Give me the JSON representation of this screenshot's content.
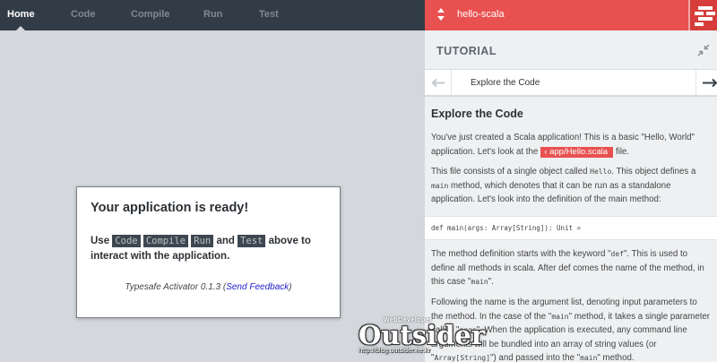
{
  "nav": {
    "tabs": [
      {
        "label": "Home",
        "active": true
      },
      {
        "label": "Code",
        "active": false
      },
      {
        "label": "Compile",
        "active": false
      },
      {
        "label": "Run",
        "active": false
      },
      {
        "label": "Test",
        "active": false
      }
    ]
  },
  "project": {
    "name": "hello-scala",
    "icons": [
      "project-switch-arrows-icon",
      "typesafe-logo-icon"
    ]
  },
  "main": {
    "card": {
      "title": "Your application is ready!",
      "line1_prefix": "Use",
      "chips": [
        "Code",
        "Compile",
        "Run",
        "Test"
      ],
      "line1_and": "and",
      "line1_suffix": "above to",
      "line2": "interact with the application.",
      "activator_text": "Typesafe Activator 0.1.3 (",
      "feedback_link": "Send Feedback",
      "activator_close": ")"
    }
  },
  "tutorial": {
    "header": "TUTORIAL",
    "nav_title": "Explore the Code",
    "heading": "Explore the Code",
    "p1_a": "You've just created a Scala application!  This is a basic \"Hello, World\" application. Let's look at the",
    "p1_file": "app/Hello.scala",
    "p1_b": "file.",
    "p2_a": "This file consists of a single object called",
    "p2_code1": "Hello",
    "p2_b": ". This object defines a",
    "p2_code2": "main",
    "p2_c": "method, which denotes that it can be run as a standalone application. Let's look into the definition of the main method:",
    "code": "def main(args: Array[String]): Unit =",
    "p3_a": "The method definition starts with the keyword \"",
    "p3_code1": "def",
    "p3_b": "\". This is used to define all methods in scala. After def comes the name of the method, in this case \"",
    "p3_code2": "main",
    "p3_c": "\".",
    "p4_a": "Following the name is the argument list, denoting input parameters to the method. In the case of the \"",
    "p4_code1": "main",
    "p4_b": "\" method, it takes a single parameter called \"",
    "p4_code2": "args",
    "p4_c": "\". When the application is executed, any command line arguments will be bundled into an array of string values (or \"",
    "p4_code3": "Array[String]",
    "p4_d": "\") and passed into the \"",
    "p4_code4": "main",
    "p4_e": "\" method."
  },
  "watermark": {
    "sub": "WebDeveloper",
    "name": "Outsider",
    "url": "http://blog.outsider.ne.kr"
  },
  "colors": {
    "nav_bg": "#323c46",
    "accent_red": "#e8514f",
    "main_bg": "#d4d8dd",
    "panel_bg": "#eef0f2"
  }
}
